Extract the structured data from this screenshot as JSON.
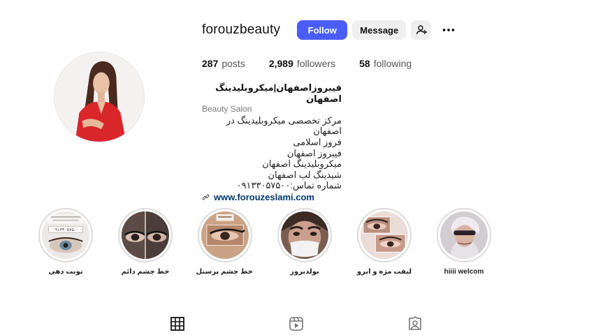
{
  "profile": {
    "username": "forouzbeauty",
    "follow_label": "Follow",
    "message_label": "Message",
    "stats": {
      "posts": "287",
      "posts_label": "posts",
      "followers": "2,989",
      "followers_label": "followers",
      "following": "58",
      "following_label": "following"
    },
    "bio": {
      "name": "فیبروزاصفهان|میکروبلیدینگ اصفهان",
      "category": "Beauty Salon",
      "lines": [
        "مرکز تخصصی میکروبلیدینگ در اصفهان",
        "فروز اسلامی",
        "فیبروز اصفهان",
        "میکروبلیدینگ اصفهان",
        "شیدینگ لب اصفهان",
        "شماره تماس:۰۹۱۳۳۰۵۷۵۰۰"
      ],
      "link": "www.forouzeslami.com"
    }
  },
  "highlights": [
    {
      "label": "نوبت دهی",
      "thumb_text": "۰۹۱۳۳۰۵۷۵۰۰",
      "colors": [
        "#d9d4cf",
        "#6b5e55"
      ]
    },
    {
      "label": "خط چشم دائم",
      "colors": [
        "#5b4a45",
        "#2b201e"
      ]
    },
    {
      "label": "خط چشم پرسنل",
      "colors": [
        "#c9a389",
        "#7b4e36"
      ]
    },
    {
      "label": "بولدبروز",
      "colors": [
        "#8b6a5c",
        "#3a2a25"
      ]
    },
    {
      "label": "لیفت مژه و ابرو",
      "colors": [
        "#c39a8b",
        "#6a4438"
      ]
    },
    {
      "label": "hiiii welcom",
      "colors": [
        "#b9b3b6",
        "#4b4347"
      ]
    }
  ],
  "icons": {
    "add_user": "add-user-icon",
    "more": "more-icon",
    "link": "link-icon",
    "grid": "grid-icon",
    "reels": "reels-icon",
    "tagged": "tagged-icon"
  },
  "colors": {
    "follow_bg": "#4a5df9",
    "link": "#00376b",
    "ring": "#dbdbdb"
  }
}
